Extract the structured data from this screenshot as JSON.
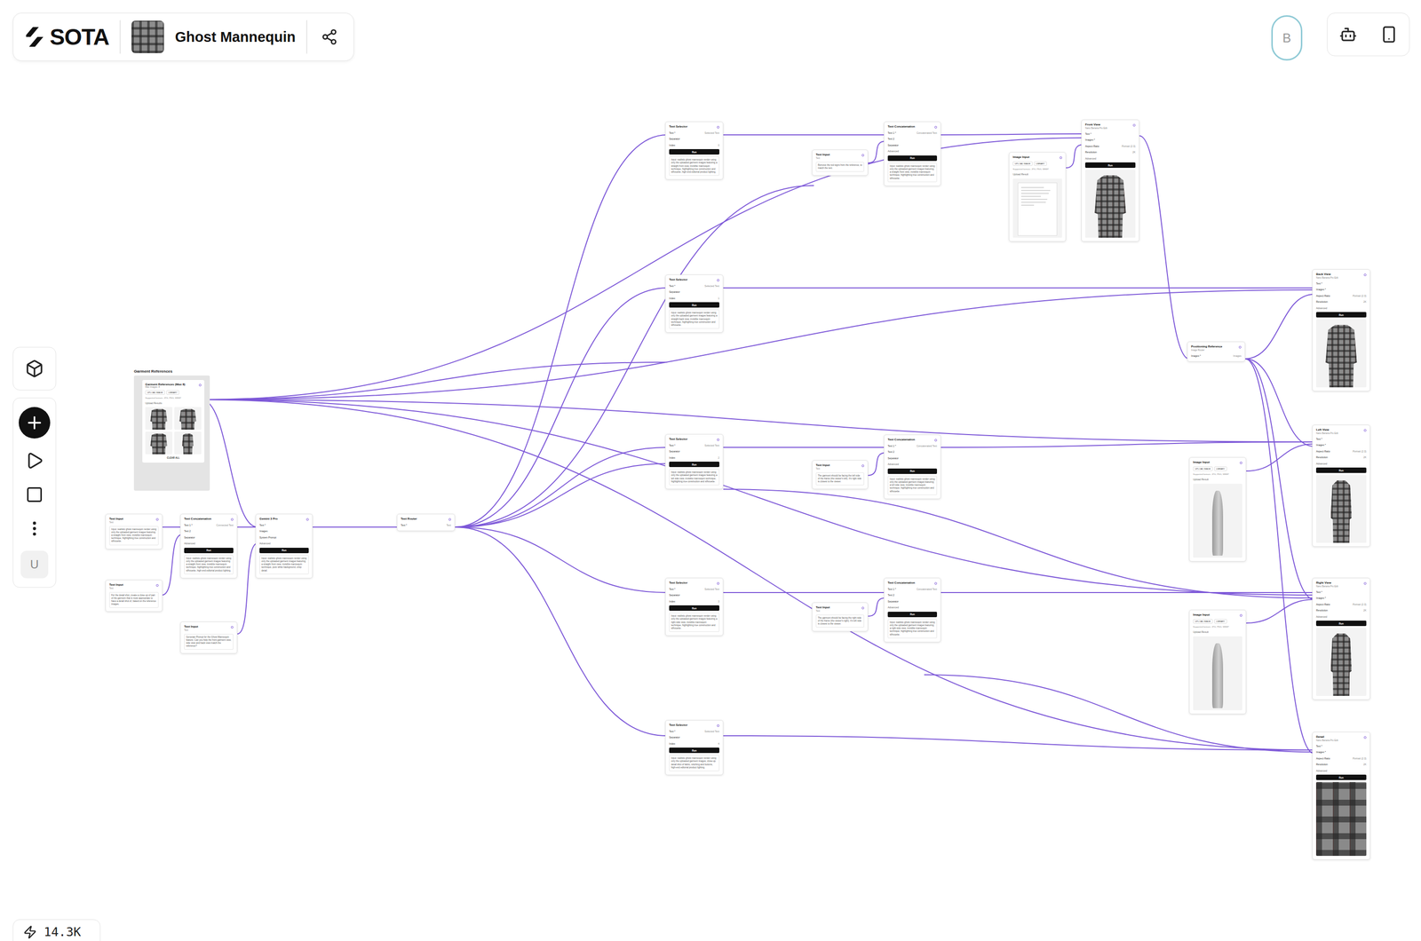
{
  "header": {
    "logo": "SOTA",
    "title": "Ghost Mannequin"
  },
  "account": {
    "avatar": "B"
  },
  "sidebar": {
    "user": "U"
  },
  "credits": "14.3K",
  "group": {
    "label": "Garment References",
    "node": {
      "title": "Garment References (Max 8)",
      "subtitle": "Max Images: 8",
      "buttons": [
        "UPLOAD IMAGE",
        "LIBRARY"
      ],
      "note": "Supported formats: JPG, PNG, WEBP",
      "section": "Upload Results",
      "images": [
        {
          "kind": "front"
        },
        {
          "kind": "back"
        },
        {
          "kind": "front"
        },
        {
          "kind": "side"
        }
      ],
      "action": "CLEAR ALL"
    }
  },
  "nodes": [
    {
      "kind": "text-input",
      "title": "Text Input",
      "subtitle": "Text",
      "text": "Input: realistic ghost mannequin render using only the uploaded garment images featuring a straight front view, invisible mannequin technique, highlighting true construction and silhouette."
    },
    {
      "kind": "text-input",
      "title": "Text Input",
      "subtitle": "Text",
      "text": "For the detail shot, create a close-up of part of the garment that is most appropriate to have a detail shot of, based on the reference images."
    },
    {
      "kind": "text-concat",
      "title": "Text Concatenation",
      "fields": [
        {
          "label": "Text 1 *",
          "value": "Connected Text"
        },
        {
          "label": "Text 2",
          "value": ""
        },
        {
          "label": "Separator",
          "value": ""
        }
      ],
      "advanced": "Advanced",
      "run": "Run",
      "text": "Input: realistic ghost mannequin render using only the uploaded garment images featuring a straight front view, invisible mannequin technique, highlighting true construction and silhouette, high-end editorial product lighting."
    },
    {
      "kind": "text-input",
      "title": "Text Input",
      "subtitle": "Text",
      "text": "Generate Prompt for the Ghost Mannequin feature. Can you help the front garment view, side view and back view match the reference?"
    },
    {
      "kind": "llm",
      "title": "Gemini 3 Pro",
      "fields": [
        {
          "label": "Text *",
          "value": ""
        },
        {
          "label": "Images",
          "value": ""
        },
        {
          "label": "System Prompt",
          "value": ""
        }
      ],
      "advanced": "Advanced",
      "run": "Run",
      "text": "Input: realistic ghost mannequin render using only the uploaded garment images featuring a straight front view, invisible mannequin technique, pure white background, crisp detail."
    },
    {
      "kind": "router",
      "title": "Text Router",
      "fields": [
        {
          "label": "Text *",
          "value": "Text"
        }
      ]
    },
    {
      "kind": "text-selector",
      "title": "Text Selector",
      "fields": [
        {
          "label": "Text *",
          "value": "Selected Text"
        },
        {
          "label": "Separator",
          "value": ""
        },
        {
          "label": "Index",
          "value": "0"
        }
      ],
      "run": "Run",
      "text": "Input: realistic ghost mannequin render using only the uploaded garment images featuring a straight front view, invisible mannequin technique, highlighting true construction and silhouette, high-end editorial product lighting."
    },
    {
      "kind": "text-selector",
      "title": "Text Selector",
      "fields": [
        {
          "label": "Text *",
          "value": "Selected Text"
        },
        {
          "label": "Separator",
          "value": ""
        },
        {
          "label": "Index",
          "value": "1"
        }
      ],
      "run": "Run",
      "text": "Input: realistic ghost mannequin render using only the uploaded garment images featuring a straight back view, invisible mannequin technique, highlighting true construction and silhouette."
    },
    {
      "kind": "text-selector",
      "title": "Text Selector",
      "fields": [
        {
          "label": "Text *",
          "value": "Selected Text"
        },
        {
          "label": "Separator",
          "value": ""
        },
        {
          "label": "Index",
          "value": "2"
        }
      ],
      "run": "Run",
      "text": "Input: realistic ghost mannequin render using only the uploaded garment images featuring a left side view, invisible mannequin technique, highlighting true construction and silhouette."
    },
    {
      "kind": "text-selector",
      "title": "Text Selector",
      "fields": [
        {
          "label": "Text *",
          "value": "Selected Text"
        },
        {
          "label": "Separator",
          "value": ""
        },
        {
          "label": "Index",
          "value": "3"
        }
      ],
      "run": "Run",
      "text": "Input: realistic ghost mannequin render using only the uploaded garment images featuring a right side view, invisible mannequin technique, highlighting true construction and silhouette."
    },
    {
      "kind": "text-selector",
      "title": "Text Selector",
      "fields": [
        {
          "label": "Text *",
          "value": "Selected Text"
        },
        {
          "label": "Separator",
          "value": ""
        },
        {
          "label": "Index",
          "value": "4"
        }
      ],
      "run": "Run",
      "text": "Input: realistic ghost mannequin render using only the uploaded garment images, close-up detail shot of fabric, stitching and buttons, high-end editorial product lighting."
    },
    {
      "kind": "text-input",
      "title": "Text Input",
      "subtitle": "Text",
      "text": "Remove the red signs from the reference, to match the text."
    },
    {
      "kind": "text-input",
      "title": "Text Input",
      "subtitle": "Text",
      "text": "The garment should be facing the left side of the frame (the viewer's left). It's right side is closest to the viewer."
    },
    {
      "kind": "text-input",
      "title": "Text Input",
      "subtitle": "Text",
      "text": "The garment should be facing the right side of the frame (the viewer's right). It's left side is closest to the viewer."
    },
    {
      "kind": "text-concat",
      "title": "Text Concatenation",
      "fields": [
        {
          "label": "Text 1 *",
          "value": "Concatenated Text"
        },
        {
          "label": "Text 2",
          "value": ""
        },
        {
          "label": "Separator",
          "value": ""
        }
      ],
      "advanced": "Advanced",
      "run": "Run",
      "text": "Input: realistic ghost mannequin render using only the uploaded garment images featuring a straight front view, invisible mannequin technique, highlighting true construction and silhouette."
    },
    {
      "kind": "text-concat",
      "title": "Text Concatenation",
      "fields": [
        {
          "label": "Text 1 *",
          "value": "Concatenated Text"
        },
        {
          "label": "Text 2",
          "value": ""
        },
        {
          "label": "Separator",
          "value": ""
        }
      ],
      "advanced": "Advanced",
      "run": "Run",
      "text": "Input: realistic ghost mannequin render using only the uploaded garment images featuring a left side view, invisible mannequin technique, highlighting true construction and silhouette."
    },
    {
      "kind": "text-concat",
      "title": "Text Concatenation",
      "fields": [
        {
          "label": "Text 1 *",
          "value": "Concatenated Text"
        },
        {
          "label": "Text 2",
          "value": ""
        },
        {
          "label": "Separator",
          "value": ""
        }
      ],
      "advanced": "Advanced",
      "run": "Run",
      "text": "Input: realistic ghost mannequin render using only the uploaded garment images featuring a right side view, invisible mannequin technique, highlighting true construction and silhouette."
    },
    {
      "kind": "image-input",
      "title": "Image Input",
      "buttons": [
        "UPLOAD IMAGE",
        "LIBRARY"
      ],
      "note": "Supported formats: JPG, PNG, WEBP",
      "section": "Upload Result",
      "preview": "document"
    },
    {
      "kind": "generate",
      "title": "Front View",
      "subtitle": "Nano Banana Pro Edit",
      "fields": [
        {
          "label": "Text *",
          "value": ""
        },
        {
          "label": "Images *",
          "value": ""
        },
        {
          "label": "Aspect Ratio",
          "value": "Portrait (2:3)"
        },
        {
          "label": "Resolution",
          "value": "2K"
        }
      ],
      "advanced": "Advanced",
      "run": "Run",
      "image": {
        "kind": "front"
      }
    },
    {
      "kind": "image-router",
      "title": "Positioning Reference",
      "subtitle": "Image Router",
      "fields": [
        {
          "label": "Images *",
          "value": "Images"
        }
      ]
    },
    {
      "kind": "image-input",
      "title": "Image Input",
      "buttons": [
        "UPLOAD IMAGE",
        "LIBRARY"
      ],
      "note": "Supported formats: JPG, PNG, WEBP",
      "section": "Upload Result",
      "preview": "mannequin-left"
    },
    {
      "kind": "image-input",
      "title": "Image Input",
      "buttons": [
        "UPLOAD IMAGE",
        "LIBRARY"
      ],
      "note": "Supported formats: JPG, PNG, WEBP",
      "section": "Upload Result",
      "preview": "mannequin-right"
    },
    {
      "kind": "generate",
      "title": "Back View",
      "subtitle": "Nano Banana Pro Edit",
      "fields": [
        {
          "label": "Text *",
          "value": ""
        },
        {
          "label": "Images *",
          "value": ""
        },
        {
          "label": "Aspect Ratio",
          "value": "Portrait (2:3)"
        },
        {
          "label": "Resolution",
          "value": "2K"
        }
      ],
      "advanced": "Advanced",
      "run": "Run",
      "image": {
        "kind": "back"
      }
    },
    {
      "kind": "generate",
      "title": "Left View",
      "subtitle": "Nano Banana Pro Edit",
      "fields": [
        {
          "label": "Text *",
          "value": ""
        },
        {
          "label": "Images *",
          "value": ""
        },
        {
          "label": "Aspect Ratio",
          "value": "Portrait (2:3)"
        },
        {
          "label": "Resolution",
          "value": "2K"
        }
      ],
      "advanced": "Advanced",
      "run": "Run",
      "image": {
        "kind": "side"
      }
    },
    {
      "kind": "generate",
      "title": "Right View",
      "subtitle": "Nano Banana Pro Edit",
      "fields": [
        {
          "label": "Text *",
          "value": ""
        },
        {
          "label": "Images *",
          "value": ""
        },
        {
          "label": "Aspect Ratio",
          "value": "Portrait (2:3)"
        },
        {
          "label": "Resolution",
          "value": "2K"
        }
      ],
      "advanced": "Advanced",
      "run": "Run",
      "image": {
        "kind": "side"
      }
    },
    {
      "kind": "generate",
      "title": "Detail",
      "subtitle": "Nano Banana Pro Edit",
      "fields": [
        {
          "label": "Text *",
          "value": ""
        },
        {
          "label": "Images *",
          "value": ""
        },
        {
          "label": "Aspect Ratio",
          "value": "Portrait (2:3)"
        },
        {
          "label": "Resolution",
          "value": "2K"
        }
      ],
      "advanced": "Advanced",
      "run": "Run",
      "image": {
        "kind": "detail"
      }
    }
  ]
}
